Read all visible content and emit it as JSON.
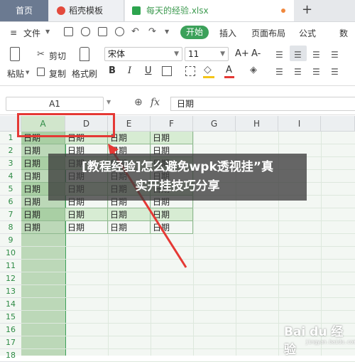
{
  "tabs": [
    {
      "label": "首页"
    },
    {
      "label": "稻壳模板"
    },
    {
      "label": "每天的经验.xlsx"
    }
  ],
  "menu": {
    "file_label": "文件",
    "start_label": "开始",
    "items": [
      "插入",
      "页面布局",
      "公式",
      "数"
    ]
  },
  "ribbon": {
    "paste_label": "粘贴",
    "cut_label": "剪切",
    "copy_label": "复制",
    "format_painter_label": "格式刷",
    "font_name": "宋体",
    "font_size": "11",
    "grow_font": "A+",
    "shrink_font": "A-",
    "bold": "B",
    "italic": "I",
    "underline": "U",
    "font_color_glyph": "A",
    "font_color": "#e53935",
    "fill_color": "#f5c518"
  },
  "formula_bar": {
    "cell_ref": "A1",
    "fx_label": "fx",
    "value": "日期"
  },
  "columns": [
    "A",
    "D",
    "E",
    "F",
    "G",
    "H",
    "I"
  ],
  "rows": [
    "1",
    "2",
    "3",
    "4",
    "5",
    "6",
    "7",
    "8",
    "9",
    "10",
    "11",
    "12",
    "13",
    "14",
    "15",
    "16",
    "17",
    "18"
  ],
  "cell_text": "日期",
  "banner": {
    "line1": "[教程经验]怎么避免wpk透视挂”真",
    "line2": "实开挂技巧分享"
  },
  "watermark": {
    "brand": "Bai du 经验",
    "url": "jingyan.baidu.com"
  },
  "colors": {
    "accent_green": "#3ca15a",
    "highlight_red": "#e53935"
  }
}
